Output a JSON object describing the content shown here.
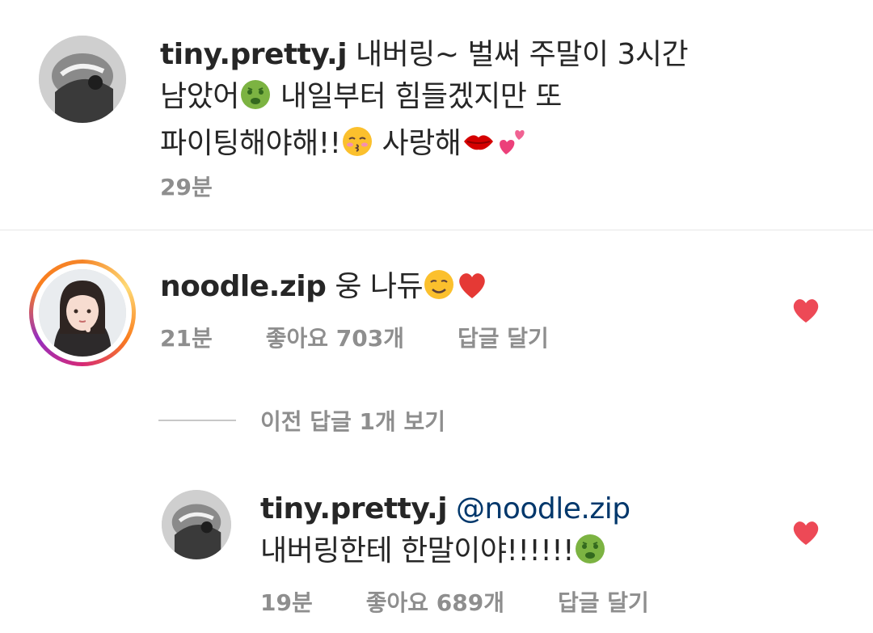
{
  "comments": [
    {
      "username": "tiny.pretty.j",
      "lines": [
        "내버링~ 벌써 주말이 3시간",
        "남았어",
        " 내일부터 힘들겠지만 또",
        "파이팅해야해!!",
        " 사랑해"
      ],
      "time": "29분",
      "icons": [
        "nauseated-face-emoji",
        "kissing-closed-eyes-emoji",
        "lips-emoji",
        "two-hearts-emoji"
      ]
    },
    {
      "username": "noodle.zip",
      "text": "웅 나듀",
      "time": "21분",
      "likes_label": "좋아요 703개",
      "reply_label": "답글 달기",
      "liked": true,
      "icons": [
        "relieved-face-emoji",
        "red-heart-emoji"
      ]
    }
  ],
  "view_previous": "이전 답글 1개 보기",
  "reply": {
    "username": "tiny.pretty.j",
    "mention": "@noodle.zip",
    "text": "내버링한테 한말이야!!!!!!",
    "time": "19분",
    "likes_label": "좋아요 689개",
    "reply_label": "답글 달기",
    "liked": true,
    "icons": [
      "nauseated-face-emoji"
    ]
  },
  "colors": {
    "like_red": "#ed4956",
    "meta_gray": "#8e8e8e",
    "mention_blue": "#00376b"
  }
}
